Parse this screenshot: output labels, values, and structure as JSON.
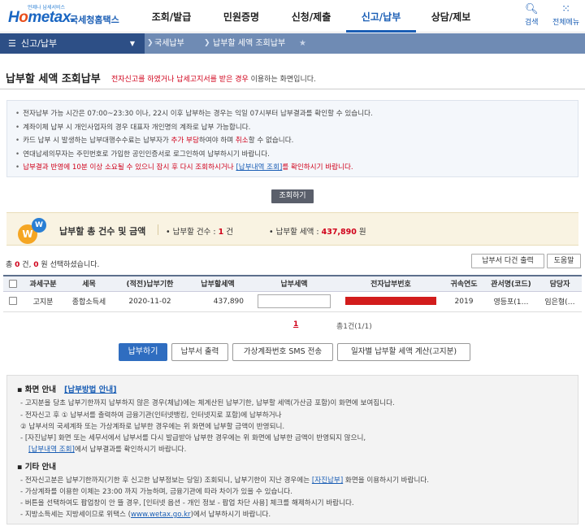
{
  "header": {
    "logo_tagline": "언제나 납세서비스",
    "logo_brand_a": "H",
    "logo_brand_o": "o",
    "logo_brand_b": "metax.",
    "logo_kr": "국세청홈택스",
    "menus": [
      "조회/발급",
      "민원증명",
      "신청/제출",
      "신고/납부",
      "상담/제보"
    ],
    "search_label": "검색",
    "allmenu_label": "전체메뉴"
  },
  "nav": {
    "section": "신고/납부",
    "crumb1": "국세납부",
    "crumb2": "납부할 세액 조회납부"
  },
  "page": {
    "title": "납부할 세액 조회납부",
    "subtitle_red": "전자신고를 하였거나 납세고지서를 받은 경우",
    "subtitle_rest": " 이용하는 화면입니다."
  },
  "notice": {
    "line1": "전자납부 가능 시간은 07:00~23:30 이나, 22시 이후 납부하는 경우는 익일 07시부터 납부결과를 확인할 수 있습니다.",
    "line2": "계좌이체 납부 시 개인사업자의 경우 대표자 개인명의 계좌로 납부 가능합니다.",
    "line3a": "카드 납부 시 발생하는 납부대행수수료는 납부자가 ",
    "line3b": "추가 부담",
    "line3c": "하여야 하며 ",
    "line3d": "취소",
    "line3e": "할 수 없습니다.",
    "line4": "연대납세의무자는 주민번호로 가입한 공인인증서로 로그인하여 납부하시기 바랍니다.",
    "line5a": "납부결과 반영에 10분 이상 소요될 수 있으니 잠시 후 다시 조회하시거나 ",
    "line5b": "[납부내역 조회]",
    "line5c": "를 확인하시기 바랍니다."
  },
  "search_button": "조회하기",
  "summary": {
    "label": "납부할 총 건수 및 금액",
    "count_label": "납부할 건수 : ",
    "count_value": "1",
    "count_unit": " 건",
    "amount_label": "납부할 세액 : ",
    "amount_value": "437,890",
    "amount_unit": " 원"
  },
  "selection": {
    "prefix": "총 ",
    "count": "0",
    "mid": " 건, ",
    "amount": "0",
    "suffix": " 원 선택하셨습니다."
  },
  "toolbar": {
    "multi_print": "납부서 다건 출력",
    "help": "도움말"
  },
  "table": {
    "headers": [
      "",
      "과세구분",
      "세목",
      "(적전)납부기한",
      "납부할세액",
      "납부세액",
      "전자납부번호",
      "귀속연도",
      "관서명(코드)",
      "담당자"
    ],
    "rows": [
      {
        "type": "고지분",
        "tax": "종합소득세",
        "deadline": "2020-11-02",
        "amount": "437,890",
        "year": "2019",
        "office": "영등포(1…",
        "manager": "임은형(…"
      }
    ]
  },
  "pagination": {
    "current": "1",
    "total": "총1건(1/1)"
  },
  "actions": {
    "pay": "납부하기",
    "print": "납부서 출력",
    "sms": "가상계좌번호 SMS 전송",
    "calc": "일자별 납부할 세액 계산(고지분)"
  },
  "info": {
    "screen_title": "▪ 화면 안내",
    "guide_link": "[납부방법 안내]",
    "s1": "- 고지분을 당초 납부기한까지 납부하지 않은 경우(체납)에는 체계산된 납부기한, 납부할 세액(가산금 포함)이 화면에 보여집니다.",
    "s2": "- 전자신고 후 ① 납부서를 출력하여 금융기관(인터넷뱅킹, 인터넷지로 포함)에 납부하거나",
    "s3": "  ② 납부서의 국세계좌 또는 가상계좌로 납부한 경우에는 위 화면에 납부할 금액이 반영되니.",
    "s4": "- [자진납부] 화면 또는 세무서에서 납부서를 다시 발급받아 납부한 경우에는 위 화면에 납부한 금액이 반영되지 않으니,",
    "s5a": "[납부내역 조회]",
    "s5b": "에서 납부결과를 확인하시기 바랍니다.",
    "etc_title": "▪ 기타 안내",
    "e1a": "- 전자신고분은 납부기한까지(기한 후 신고한 납부정보는 당일) 조회되니, 납부기한이 지난 경우에는 ",
    "e1b": "[자진납부]",
    "e1c": " 화면을 이용하시기 바랍니다.",
    "e2": "- 가상계좌를 이용한 이체는 23:00 까지 가능하며, 금융기관에 따라 차이가 있을 수 있습니다.",
    "e3": "- 버튼을 선택하여도 팝업창이 안 뜰 경우, [인터넷 옵션 - 개인 정보 - 팝업 차단 사용] 체크를 해제하시기 바랍니다.",
    "e4a": "- 지방소득세는 지방세이므로 위택스 (",
    "e4b": "www.wetax.go.kr",
    "e4c": ")에서 납부하시기 바랍니다."
  }
}
